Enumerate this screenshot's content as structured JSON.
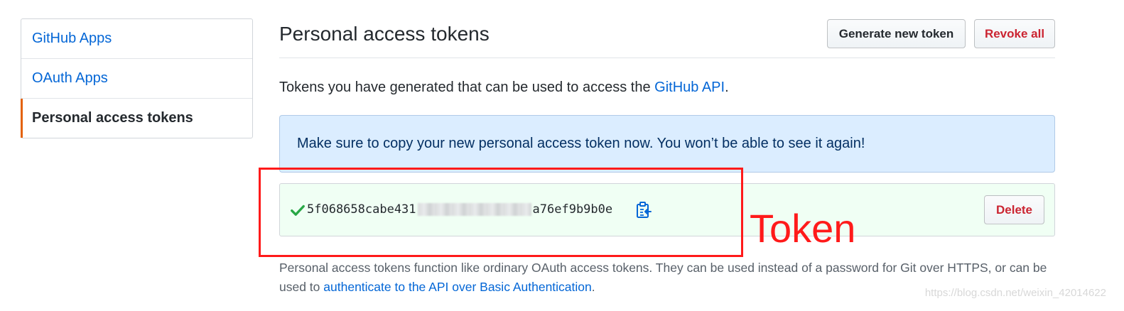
{
  "sidebar": {
    "items": [
      {
        "label": "GitHub Apps"
      },
      {
        "label": "OAuth Apps"
      },
      {
        "label": "Personal access tokens"
      }
    ]
  },
  "header": {
    "title": "Personal access tokens",
    "generate_label": "Generate new token",
    "revoke_label": "Revoke all"
  },
  "description": {
    "text": "Tokens you have generated that can be used to access the ",
    "link": "GitHub API",
    "suffix": "."
  },
  "flash": {
    "message": "Make sure to copy your new personal access token now. You won’t be able to see it again!"
  },
  "token": {
    "value_start": "5f068658cabe431",
    "value_end": "a76ef9b9b0e",
    "delete_label": "Delete"
  },
  "note": {
    "text": "Personal access tokens function like ordinary OAuth access tokens. They can be used instead of a password for Git over HTTPS, or can be used to ",
    "link": "authenticate to the API over Basic Authentication",
    "suffix": "."
  },
  "annotation": {
    "label": "Token"
  },
  "watermark": "https://blog.csdn.net/weixin_42014622",
  "colors": {
    "link": "#0366d6",
    "danger": "#cb2431",
    "flash_bg": "#dbedff",
    "success_bg": "#f0fff4",
    "selected_accent": "#e36209",
    "annotation": "#ff1a1a"
  }
}
